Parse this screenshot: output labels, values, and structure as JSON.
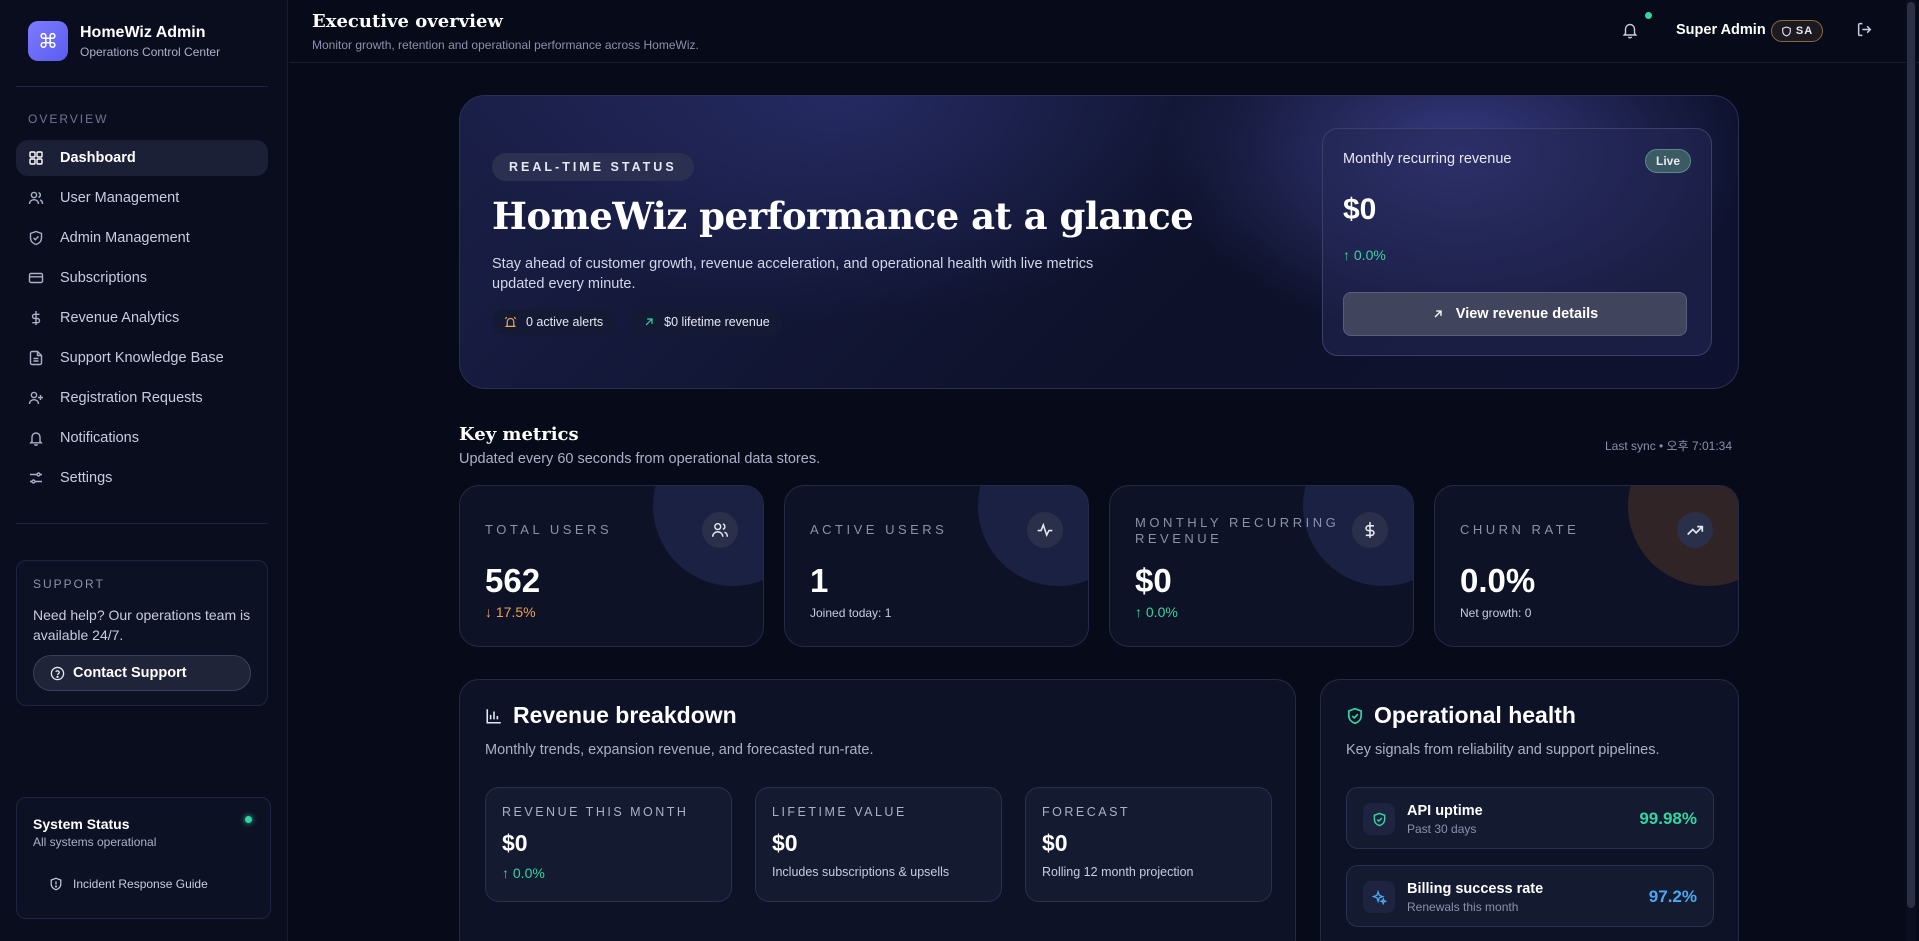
{
  "brand": {
    "title": "HomeWiz Admin",
    "subtitle": "Operations Control Center"
  },
  "sidebar": {
    "section_label": "OVERVIEW",
    "items": [
      {
        "label": "Dashboard",
        "icon": "grid-icon",
        "active": true
      },
      {
        "label": "User Management",
        "icon": "users-icon"
      },
      {
        "label": "Admin Management",
        "icon": "shield-icon"
      },
      {
        "label": "Subscriptions",
        "icon": "credit-card-icon"
      },
      {
        "label": "Revenue Analytics",
        "icon": "dollar-icon"
      },
      {
        "label": "Support Knowledge Base",
        "icon": "document-icon"
      },
      {
        "label": "Registration Requests",
        "icon": "user-plus-icon"
      },
      {
        "label": "Notifications",
        "icon": "bell-icon"
      },
      {
        "label": "Settings",
        "icon": "sliders-icon"
      }
    ],
    "support": {
      "label": "SUPPORT",
      "text": "Need help? Our operations team is available 24/7.",
      "button": "Contact Support"
    },
    "system_status": {
      "title": "System Status",
      "subtitle": "All systems operational",
      "link": "Incident Response Guide"
    }
  },
  "topbar": {
    "title": "Executive overview",
    "subtitle": "Monitor growth, retention and operational performance across HomeWiz.",
    "user_name": "Super Admin",
    "role_badge": "SA"
  },
  "hero": {
    "pill": "REAL-TIME STATUS",
    "title": "HomeWiz performance at a glance",
    "description": "Stay ahead of customer growth, revenue acceleration, and operational health with live metrics updated every minute.",
    "chips": [
      "0 active alerts",
      "$0 lifetime revenue"
    ],
    "mrr_card": {
      "label": "Monthly recurring revenue",
      "badge": "Live",
      "value": "$0",
      "change": "0.0%",
      "button": "View revenue details"
    }
  },
  "key_metrics": {
    "title": "Key metrics",
    "subtitle": "Updated every 60 seconds from operational data stores.",
    "last_sync": "Last sync • 오후 7:01:34",
    "cards": [
      {
        "label": "TOTAL USERS",
        "value": "562",
        "foot": "17.5%",
        "trend": "down",
        "icon": "users-icon"
      },
      {
        "label": "ACTIVE USERS",
        "value": "1",
        "foot": "Joined today: 1",
        "trend": "plain",
        "icon": "activity-icon"
      },
      {
        "label": "MONTHLY RECURRING REVENUE",
        "value": "$0",
        "foot": "0.0%",
        "trend": "up",
        "icon": "dollar-icon"
      },
      {
        "label": "CHURN RATE",
        "value": "0.0%",
        "foot": "Net growth: 0",
        "trend": "plain",
        "icon": "trending-up-icon"
      }
    ]
  },
  "revenue_breakdown": {
    "title": "Revenue breakdown",
    "subtitle": "Monthly trends, expansion revenue, and forecasted run-rate.",
    "boxes": [
      {
        "label": "REVENUE THIS MONTH",
        "value": "$0",
        "foot": "0.0%",
        "trend": "up"
      },
      {
        "label": "LIFETIME VALUE",
        "value": "$0",
        "foot": "Includes subscriptions & upsells",
        "trend": "plain"
      },
      {
        "label": "FORECAST",
        "value": "$0",
        "foot": "Rolling 12 month projection",
        "trend": "plain"
      }
    ]
  },
  "operational_health": {
    "title": "Operational health",
    "subtitle": "Key signals from reliability and support pipelines.",
    "items": [
      {
        "title": "API uptime",
        "subtitle": "Past 30 days",
        "value": "99.98%",
        "color": "#33d6a0"
      },
      {
        "title": "Billing success rate",
        "subtitle": "Renewals this month",
        "value": "97.2%",
        "color": "#4aa8f0"
      }
    ]
  },
  "colors": {
    "accent": "#6c6cff",
    "positive": "#33d6a0",
    "negative": "#f0a050",
    "info": "#4aa8f0"
  }
}
